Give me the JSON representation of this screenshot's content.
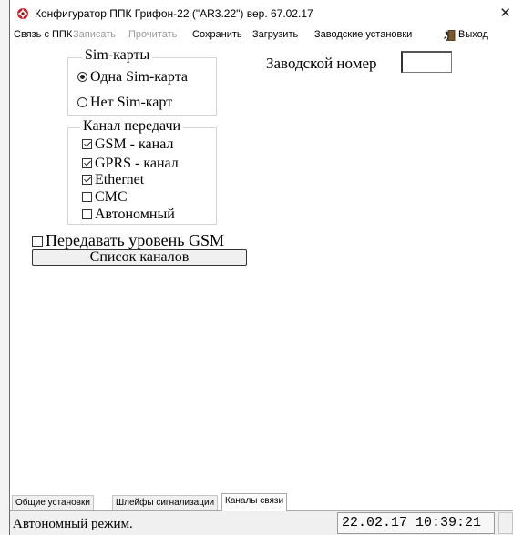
{
  "window": {
    "title": "Конфигуратор ППК Грифон-22 (\"AR3.22\") вер. 67.02.17",
    "close_glyph": "✕",
    "icon": "app-icon"
  },
  "menu": {
    "items": [
      "Связь с ППК",
      "Записать",
      "Прочитать",
      "Сохранить",
      "Загрузить",
      "Заводские установки"
    ],
    "exit_label": "Выход",
    "disabled_items": [
      "Записать",
      "Прочитать"
    ]
  },
  "sim": {
    "title": "Sim-карты",
    "options": [
      "Одна Sim-карта",
      "Нет Sim-карт"
    ],
    "selected": 0
  },
  "channels": {
    "title": "Канал передачи",
    "items": [
      {
        "label": "GSM - канал",
        "checked": true
      },
      {
        "label": "GPRS - канал",
        "checked": true
      },
      {
        "label": "Ethernet",
        "checked": true
      },
      {
        "label": "СМС",
        "checked": false
      },
      {
        "label": "Автономный",
        "checked": false
      }
    ]
  },
  "serial": {
    "label": "Заводской номер",
    "value": ""
  },
  "gsm_level": {
    "label": "Передавать уровень GSM",
    "checked": false
  },
  "list_button": "Список каналов",
  "tabs": {
    "items": [
      "Общие установки",
      "Шлейфы сигнализации",
      "Каналы связи"
    ],
    "active": 2
  },
  "status": {
    "mode": "Автономный режим.",
    "datetime": "22.02.17  10:39:21"
  },
  "colors": {
    "icon_red": "#c8232c",
    "disabled_text": "#9a9a9a"
  }
}
